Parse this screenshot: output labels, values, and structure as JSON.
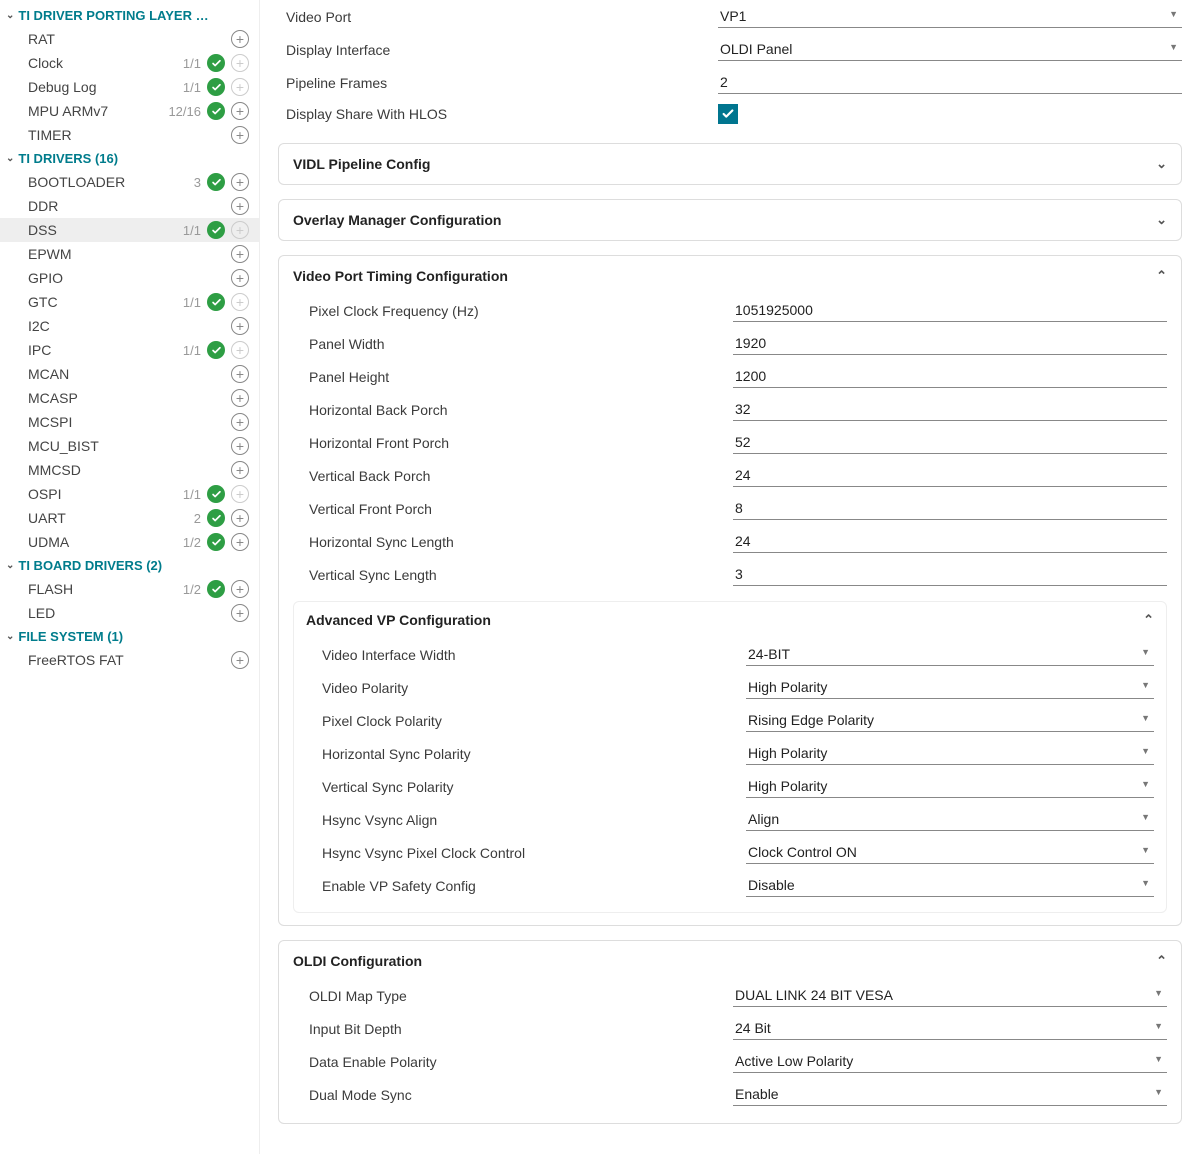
{
  "sidebar": {
    "groups": [
      {
        "title": "TI DRIVER PORTING LAYER …",
        "items": [
          {
            "label": "RAT"
          },
          {
            "label": "Clock",
            "count": "1/1",
            "check": true,
            "dim": true
          },
          {
            "label": "Debug Log",
            "count": "1/1",
            "check": true,
            "dim": true
          },
          {
            "label": "MPU ARMv7",
            "count": "12/16",
            "check": true
          },
          {
            "label": "TIMER"
          }
        ]
      },
      {
        "title": "TI DRIVERS (16)",
        "items": [
          {
            "label": "BOOTLOADER",
            "count": "3",
            "check": true
          },
          {
            "label": "DDR"
          },
          {
            "label": "DSS",
            "count": "1/1",
            "check": true,
            "selected": true,
            "dim": true
          },
          {
            "label": "EPWM"
          },
          {
            "label": "GPIO"
          },
          {
            "label": "GTC",
            "count": "1/1",
            "check": true,
            "dim": true
          },
          {
            "label": "I2C"
          },
          {
            "label": "IPC",
            "count": "1/1",
            "check": true,
            "dim": true
          },
          {
            "label": "MCAN"
          },
          {
            "label": "MCASP"
          },
          {
            "label": "MCSPI"
          },
          {
            "label": "MCU_BIST"
          },
          {
            "label": "MMCSD"
          },
          {
            "label": "OSPI",
            "count": "1/1",
            "check": true,
            "dim": true
          },
          {
            "label": "UART",
            "count": "2",
            "check": true
          },
          {
            "label": "UDMA",
            "count": "1/2",
            "check": true
          }
        ]
      },
      {
        "title": "TI BOARD DRIVERS (2)",
        "items": [
          {
            "label": "FLASH",
            "count": "1/2",
            "check": true
          },
          {
            "label": "LED"
          }
        ]
      },
      {
        "title": "FILE SYSTEM (1)",
        "items": [
          {
            "label": "FreeRTOS FAT"
          }
        ]
      }
    ]
  },
  "main": {
    "top": [
      {
        "label": "Video Port",
        "value": "VP1",
        "type": "select"
      },
      {
        "label": "Display Interface",
        "value": "OLDI Panel",
        "type": "select"
      },
      {
        "label": "Pipeline Frames",
        "value": "2",
        "type": "text"
      },
      {
        "label": "Display Share With HLOS",
        "value": "",
        "type": "checkbox"
      }
    ],
    "panels": {
      "vidl": {
        "title": "VIDL Pipeline Config",
        "collapsed": true
      },
      "overlay": {
        "title": "Overlay Manager Configuration",
        "collapsed": true
      },
      "vptiming": {
        "title": "Video Port Timing Configuration",
        "fields": [
          {
            "label": "Pixel Clock Frequency (Hz)",
            "value": "1051925000"
          },
          {
            "label": "Panel Width",
            "value": "1920"
          },
          {
            "label": "Panel Height",
            "value": "1200"
          },
          {
            "label": "Horizontal Back Porch",
            "value": "32"
          },
          {
            "label": "Horizontal Front Porch",
            "value": "52"
          },
          {
            "label": "Vertical Back Porch",
            "value": "24"
          },
          {
            "label": "Vertical Front Porch",
            "value": "8"
          },
          {
            "label": "Horizontal Sync Length",
            "value": "24"
          },
          {
            "label": "Vertical Sync Length",
            "value": "3"
          }
        ],
        "advanced": {
          "title": "Advanced VP Configuration",
          "fields": [
            {
              "label": "Video Interface Width",
              "value": "24-BIT"
            },
            {
              "label": "Video Polarity",
              "value": "High Polarity"
            },
            {
              "label": "Pixel Clock Polarity",
              "value": "Rising Edge Polarity"
            },
            {
              "label": "Horizontal Sync Polarity",
              "value": "High Polarity"
            },
            {
              "label": "Vertical Sync Polarity",
              "value": "High Polarity"
            },
            {
              "label": "Hsync Vsync Align",
              "value": "Align"
            },
            {
              "label": "Hsync Vsync Pixel Clock Control",
              "value": "Clock Control ON"
            },
            {
              "label": "Enable VP Safety Config",
              "value": "Disable"
            }
          ]
        }
      },
      "oldi": {
        "title": "OLDI Configuration",
        "fields": [
          {
            "label": "OLDI Map Type",
            "value": "DUAL LINK 24 BIT VESA"
          },
          {
            "label": "Input Bit Depth",
            "value": "24 Bit"
          },
          {
            "label": "Data Enable Polarity",
            "value": "Active Low Polarity"
          },
          {
            "label": "Dual Mode Sync",
            "value": "Enable"
          }
        ]
      }
    }
  }
}
